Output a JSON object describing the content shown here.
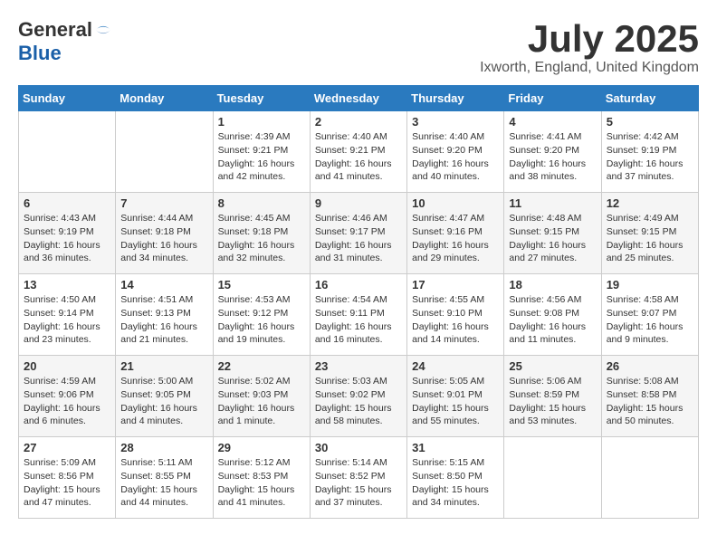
{
  "header": {
    "logo_general": "General",
    "logo_blue": "Blue",
    "month_title": "July 2025",
    "location": "Ixworth, England, United Kingdom"
  },
  "days_of_week": [
    "Sunday",
    "Monday",
    "Tuesday",
    "Wednesday",
    "Thursday",
    "Friday",
    "Saturday"
  ],
  "weeks": [
    [
      {
        "day": "",
        "info": ""
      },
      {
        "day": "",
        "info": ""
      },
      {
        "day": "1",
        "info": "Sunrise: 4:39 AM\nSunset: 9:21 PM\nDaylight: 16 hours and 42 minutes."
      },
      {
        "day": "2",
        "info": "Sunrise: 4:40 AM\nSunset: 9:21 PM\nDaylight: 16 hours and 41 minutes."
      },
      {
        "day": "3",
        "info": "Sunrise: 4:40 AM\nSunset: 9:20 PM\nDaylight: 16 hours and 40 minutes."
      },
      {
        "day": "4",
        "info": "Sunrise: 4:41 AM\nSunset: 9:20 PM\nDaylight: 16 hours and 38 minutes."
      },
      {
        "day": "5",
        "info": "Sunrise: 4:42 AM\nSunset: 9:19 PM\nDaylight: 16 hours and 37 minutes."
      }
    ],
    [
      {
        "day": "6",
        "info": "Sunrise: 4:43 AM\nSunset: 9:19 PM\nDaylight: 16 hours and 36 minutes."
      },
      {
        "day": "7",
        "info": "Sunrise: 4:44 AM\nSunset: 9:18 PM\nDaylight: 16 hours and 34 minutes."
      },
      {
        "day": "8",
        "info": "Sunrise: 4:45 AM\nSunset: 9:18 PM\nDaylight: 16 hours and 32 minutes."
      },
      {
        "day": "9",
        "info": "Sunrise: 4:46 AM\nSunset: 9:17 PM\nDaylight: 16 hours and 31 minutes."
      },
      {
        "day": "10",
        "info": "Sunrise: 4:47 AM\nSunset: 9:16 PM\nDaylight: 16 hours and 29 minutes."
      },
      {
        "day": "11",
        "info": "Sunrise: 4:48 AM\nSunset: 9:15 PM\nDaylight: 16 hours and 27 minutes."
      },
      {
        "day": "12",
        "info": "Sunrise: 4:49 AM\nSunset: 9:15 PM\nDaylight: 16 hours and 25 minutes."
      }
    ],
    [
      {
        "day": "13",
        "info": "Sunrise: 4:50 AM\nSunset: 9:14 PM\nDaylight: 16 hours and 23 minutes."
      },
      {
        "day": "14",
        "info": "Sunrise: 4:51 AM\nSunset: 9:13 PM\nDaylight: 16 hours and 21 minutes."
      },
      {
        "day": "15",
        "info": "Sunrise: 4:53 AM\nSunset: 9:12 PM\nDaylight: 16 hours and 19 minutes."
      },
      {
        "day": "16",
        "info": "Sunrise: 4:54 AM\nSunset: 9:11 PM\nDaylight: 16 hours and 16 minutes."
      },
      {
        "day": "17",
        "info": "Sunrise: 4:55 AM\nSunset: 9:10 PM\nDaylight: 16 hours and 14 minutes."
      },
      {
        "day": "18",
        "info": "Sunrise: 4:56 AM\nSunset: 9:08 PM\nDaylight: 16 hours and 11 minutes."
      },
      {
        "day": "19",
        "info": "Sunrise: 4:58 AM\nSunset: 9:07 PM\nDaylight: 16 hours and 9 minutes."
      }
    ],
    [
      {
        "day": "20",
        "info": "Sunrise: 4:59 AM\nSunset: 9:06 PM\nDaylight: 16 hours and 6 minutes."
      },
      {
        "day": "21",
        "info": "Sunrise: 5:00 AM\nSunset: 9:05 PM\nDaylight: 16 hours and 4 minutes."
      },
      {
        "day": "22",
        "info": "Sunrise: 5:02 AM\nSunset: 9:03 PM\nDaylight: 16 hours and 1 minute."
      },
      {
        "day": "23",
        "info": "Sunrise: 5:03 AM\nSunset: 9:02 PM\nDaylight: 15 hours and 58 minutes."
      },
      {
        "day": "24",
        "info": "Sunrise: 5:05 AM\nSunset: 9:01 PM\nDaylight: 15 hours and 55 minutes."
      },
      {
        "day": "25",
        "info": "Sunrise: 5:06 AM\nSunset: 8:59 PM\nDaylight: 15 hours and 53 minutes."
      },
      {
        "day": "26",
        "info": "Sunrise: 5:08 AM\nSunset: 8:58 PM\nDaylight: 15 hours and 50 minutes."
      }
    ],
    [
      {
        "day": "27",
        "info": "Sunrise: 5:09 AM\nSunset: 8:56 PM\nDaylight: 15 hours and 47 minutes."
      },
      {
        "day": "28",
        "info": "Sunrise: 5:11 AM\nSunset: 8:55 PM\nDaylight: 15 hours and 44 minutes."
      },
      {
        "day": "29",
        "info": "Sunrise: 5:12 AM\nSunset: 8:53 PM\nDaylight: 15 hours and 41 minutes."
      },
      {
        "day": "30",
        "info": "Sunrise: 5:14 AM\nSunset: 8:52 PM\nDaylight: 15 hours and 37 minutes."
      },
      {
        "day": "31",
        "info": "Sunrise: 5:15 AM\nSunset: 8:50 PM\nDaylight: 15 hours and 34 minutes."
      },
      {
        "day": "",
        "info": ""
      },
      {
        "day": "",
        "info": ""
      }
    ]
  ]
}
